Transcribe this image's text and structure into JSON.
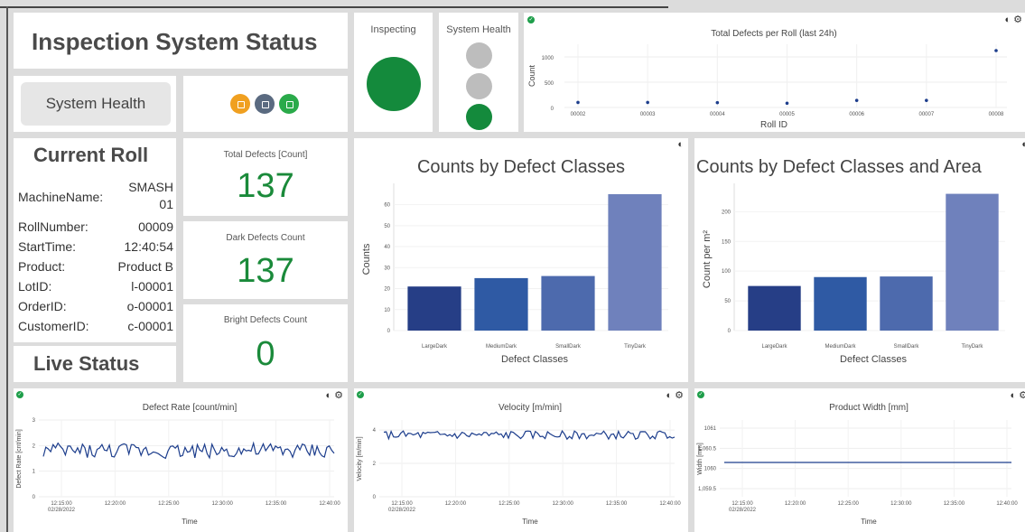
{
  "header": {
    "title": "Inspection System Status"
  },
  "system_health_button": {
    "label": "System Health"
  },
  "status_lights": [
    {
      "name": "warning",
      "color": "#f0a020"
    },
    {
      "name": "info",
      "color": "#5a6a80"
    },
    {
      "name": "ok",
      "color": "#2aaa4a"
    }
  ],
  "inspecting": {
    "title": "Inspecting",
    "color": "#148a3c"
  },
  "system_health_panel": {
    "title": "System Health",
    "lights": [
      "#bdbdbd",
      "#bdbdbd",
      "#148a3c"
    ]
  },
  "current_roll": {
    "title": "Current Roll",
    "fields": [
      {
        "key": "MachineName:",
        "value": "SMASH 01"
      },
      {
        "key": "RollNumber:",
        "value": "00009"
      },
      {
        "key": "StartTime:",
        "value": "12:40:54"
      },
      {
        "key": "Product:",
        "value": "Product B"
      },
      {
        "key": "LotID:",
        "value": "l-00001"
      },
      {
        "key": "OrderID:",
        "value": "o-00001"
      },
      {
        "key": "CustomerID:",
        "value": "c-00001"
      }
    ]
  },
  "live_status": {
    "title": "Live Status"
  },
  "metrics": [
    {
      "label": "Total Defects [Count]",
      "value": "137"
    },
    {
      "label": "Dark Defects Count",
      "value": "137"
    },
    {
      "label": "Bright Defects Count",
      "value": "0"
    }
  ],
  "charts": {
    "defects_per_roll": {
      "type": "scatter",
      "title": "Total Defects per Roll (last 24h)",
      "xlabel": "Roll ID",
      "ylabel": "Count",
      "categories": [
        "00002",
        "00003",
        "00004",
        "00005",
        "00006",
        "00007",
        "00008"
      ],
      "values": [
        100,
        100,
        95,
        85,
        140,
        140,
        1125
      ],
      "yticks": [
        "0",
        "500",
        "1000"
      ],
      "ylim": [
        0,
        1250
      ]
    },
    "counts_by_class": {
      "type": "bar",
      "title": "Counts by Defect Classes",
      "xlabel": "Defect Classes",
      "ylabel": "Counts",
      "categories": [
        "LargeDark",
        "MediumDark",
        "SmallDark",
        "TinyDark"
      ],
      "values": [
        21,
        25,
        26,
        65
      ],
      "colors": [
        "#263e86",
        "#2f5aa4",
        "#4d6aad",
        "#6f81bc"
      ],
      "yticks": [
        "0",
        "10",
        "20",
        "30",
        "40",
        "50",
        "60"
      ],
      "ylim": [
        0,
        68
      ]
    },
    "counts_by_area": {
      "type": "bar",
      "title": "Counts by Defect Classes and Area",
      "xlabel": "Defect Classes",
      "ylabel": "Count per m²",
      "categories": [
        "LargeDark",
        "MediumDark",
        "SmallDark",
        "TinyDark"
      ],
      "values": [
        75,
        90,
        91,
        230
      ],
      "colors": [
        "#263e86",
        "#2f5aa4",
        "#4d6aad",
        "#6f81bc"
      ],
      "yticks": [
        "0",
        "50",
        "100",
        "150",
        "200"
      ],
      "ylim": [
        0,
        240
      ]
    },
    "defect_rate": {
      "type": "line",
      "title": "Defect Rate [count/min]",
      "xlabel": "Time",
      "ylabel": "Defect Rate [cnt/min]",
      "xticks": [
        "12:15:00",
        "12:20:00",
        "12:25:00",
        "12:30:00",
        "12:35:00",
        "12:40:00"
      ],
      "xdate": "02/28/2022",
      "yticks": [
        "0",
        "1",
        "2",
        "3"
      ],
      "ylim": [
        0,
        3
      ],
      "mean": 1.8,
      "amplitude": 0.3
    },
    "velocity": {
      "type": "line",
      "title": "Velocity [m/min]",
      "xlabel": "Time",
      "ylabel": "Velocity [m/min]",
      "xticks": [
        "12:15:00",
        "12:20:00",
        "12:25:00",
        "12:30:00",
        "12:35:00",
        "12:40:00"
      ],
      "xdate": "02/28/2022",
      "yticks": [
        "0",
        "2",
        "4"
      ],
      "ylim": [
        0,
        4.6
      ],
      "mean": 3.7,
      "amplitude": 0.25
    },
    "product_width": {
      "type": "line",
      "title": "Product Width [mm]",
      "xlabel": "Time",
      "ylabel": "Width [mm]",
      "xticks": [
        "12:15:00",
        "12:20:00",
        "12:25:00",
        "12:30:00",
        "12:35:00",
        "12:40:00"
      ],
      "xdate": "02/28/2022",
      "yticks": [
        "1,059.5",
        "1060",
        "1,060.5",
        "1061"
      ],
      "ylim": [
        1059.3,
        1061.2
      ],
      "mean": 1060.15,
      "amplitude": 0
    }
  }
}
